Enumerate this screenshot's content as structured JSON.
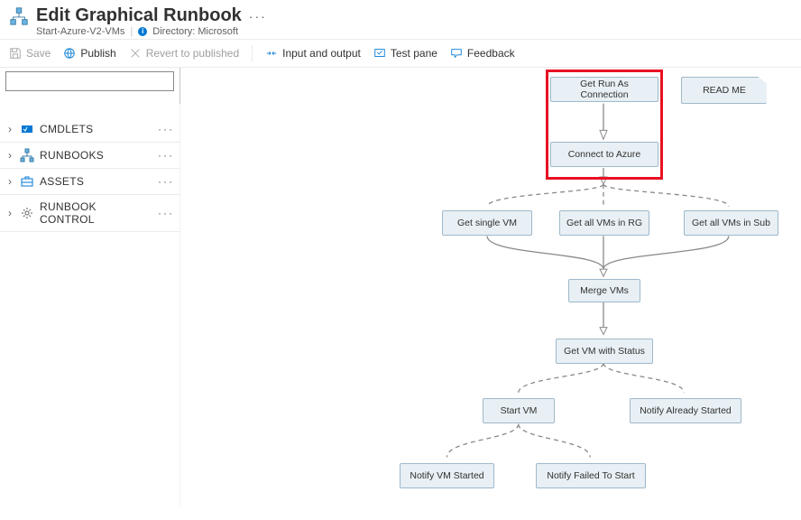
{
  "header": {
    "title": "Edit Graphical Runbook",
    "subtitle_name": "Start-Azure-V2-VMs",
    "directory_label": "Directory: Microsoft"
  },
  "toolbar": {
    "save": "Save",
    "publish": "Publish",
    "revert": "Revert to published",
    "io": "Input and output",
    "testpane": "Test pane",
    "feedback": "Feedback"
  },
  "sidebar": {
    "items": [
      {
        "label": "CMDLETS"
      },
      {
        "label": "RUNBOOKS"
      },
      {
        "label": "ASSETS"
      },
      {
        "label": "RUNBOOK CONTROL"
      }
    ]
  },
  "nodes": {
    "get_conn": "Get Run As Connection",
    "connect": "Connect to Azure",
    "readme": "READ ME",
    "single_vm": "Get single VM",
    "vms_rg": "Get all VMs in RG",
    "vms_sub": "Get all VMs in Sub",
    "merge": "Merge VMs",
    "status": "Get VM with Status",
    "startvm": "Start VM",
    "already": "Notify Already Started",
    "started": "Notify VM Started",
    "failed": "Notify Failed To Start"
  }
}
